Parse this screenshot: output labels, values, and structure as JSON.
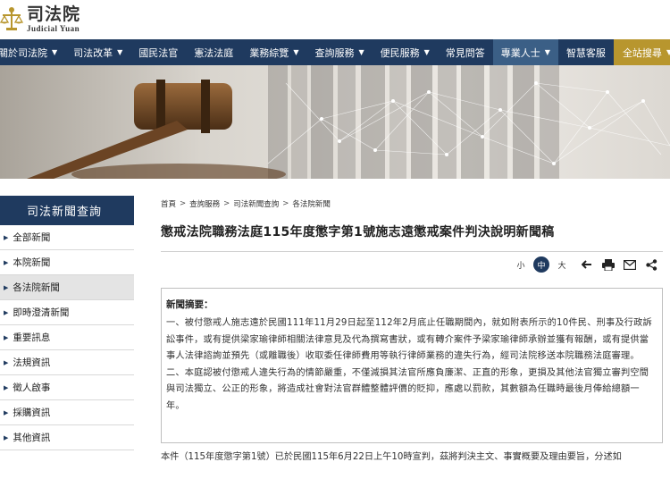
{
  "header": {
    "logo_cn": "司法院",
    "logo_en": "Judicial Yuan"
  },
  "nav": {
    "items": [
      {
        "label": "關於司法院",
        "caret": true
      },
      {
        "label": "司法改革",
        "caret": true
      },
      {
        "label": "國民法官",
        "caret": false
      },
      {
        "label": "憲法法庭",
        "caret": false
      },
      {
        "label": "業務綜覽",
        "caret": true
      },
      {
        "label": "查詢服務",
        "caret": true
      },
      {
        "label": "便民服務",
        "caret": true
      },
      {
        "label": "常見問答",
        "caret": false
      },
      {
        "label": "專業人士",
        "caret": true
      },
      {
        "label": "智慧客服",
        "caret": false
      }
    ],
    "search_label": "全站搜尋"
  },
  "sidebar": {
    "title": "司法新聞查詢",
    "items": [
      {
        "label": "全部新聞"
      },
      {
        "label": "本院新聞"
      },
      {
        "label": "各法院新聞"
      },
      {
        "label": "即時澄清新聞"
      },
      {
        "label": "重要訊息"
      },
      {
        "label": "法規資訊"
      },
      {
        "label": "徵人啟事"
      },
      {
        "label": "採購資訊"
      },
      {
        "label": "其他資訊"
      }
    ]
  },
  "breadcrumb": [
    "首頁",
    "查詢服務",
    "司法新聞查詢",
    "各法院新聞"
  ],
  "article": {
    "title": "懲戒法院職務法庭115年度懲字第1號施志遠懲戒案件判決說明新聞稿",
    "font_sizes": [
      "小",
      "中",
      "大"
    ],
    "summary_heading": "新聞摘要：",
    "summary_p1": "一、被付懲戒人施志遠於民國111年11月29日起至112年2月底止任職期間內，就如附表所示的10件民、刑事及行政訴訟事件，或有提供梁家瑜律師相關法律意見及代為撰寫書狀，或有轉介案件予梁家瑜律師承辦並獲有報酬，或有提供當事人法律諮詢並預先（或離職後）收取委任律師費用等執行律師業務的違失行為，經司法院移送本院職務法庭審理。",
    "summary_p2": "二、本庭認被付懲戒人違失行為的情節嚴重，不僅減損其法官所應負廉潔、正直的形象，更損及其他法官獨立審判空間與司法獨立、公正的形象，將造成社會對法官群體整體評價的貶抑，應處以罰款，其數額為任職時最後月俸給總額一年。",
    "body": "本件（115年度懲字第1號）已於民國115年6月22日上午10時宣判，茲將判決主文、事實概要及理由要旨，分述如"
  },
  "colors": {
    "navy": "#1f3a5f",
    "gold": "#b8962e"
  }
}
